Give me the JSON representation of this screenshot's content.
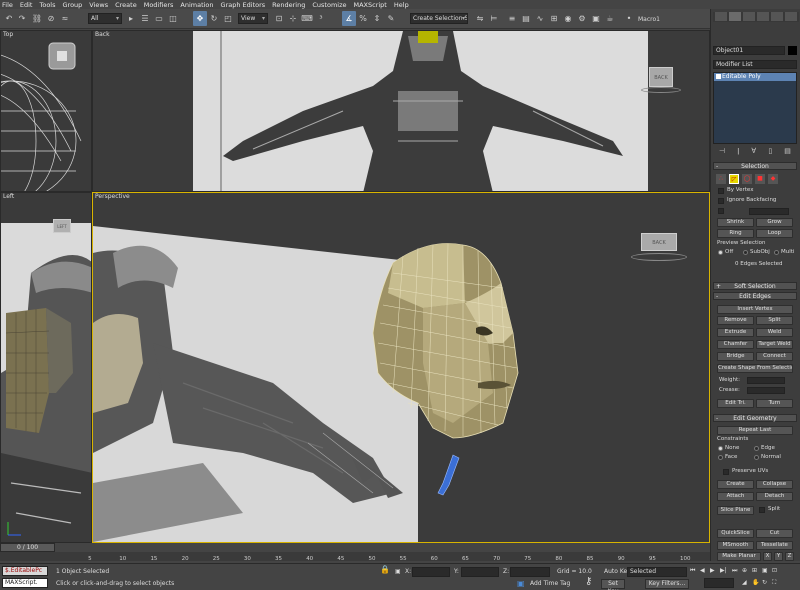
{
  "menu": [
    "File",
    "Edit",
    "Tools",
    "Group",
    "Views",
    "Create",
    "Modifiers",
    "Animation",
    "Graph Editors",
    "Rendering",
    "Customize",
    "MAXScript",
    "Help"
  ],
  "toolbar": {
    "filter_value": "All",
    "refcoord_value": "View",
    "named_selection_placeholder": "Create Selection Se",
    "macro_label": "Macro1"
  },
  "viewports": {
    "top_label": "Top",
    "back_label": "Back",
    "left_label": "Left",
    "perspective_label": "Perspective",
    "viewcube_back": "BACK",
    "viewcube_left": "LEFT",
    "viewcube_persp": "BACK"
  },
  "command_panel": {
    "object_name": "Object01",
    "modifier_list": "Modifier List",
    "stack_item": "Editable Poly",
    "selection": {
      "title": "Selection",
      "by_vertex": "By Vertex",
      "ignore_backfacing": "Ignore Backfacing",
      "shrink": "Shrink",
      "grow": "Grow",
      "ring": "Ring",
      "loop": "Loop",
      "preview_selection": "Preview Selection",
      "off": "Off",
      "subobj": "SubObj",
      "multi": "Multi",
      "status": "0 Edges Selected"
    },
    "soft_selection": "Soft Selection",
    "edit_edges": {
      "title": "Edit Edges",
      "insert_vertex": "Insert Vertex",
      "remove": "Remove",
      "split": "Split",
      "extrude": "Extrude",
      "weld": "Weld",
      "chamfer": "Chamfer",
      "target_weld": "Target Weld",
      "bridge": "Bridge",
      "connect": "Connect",
      "create_shape": "Create Shape From Selection",
      "weight": "Weight:",
      "crease": "Crease:",
      "edit_tri": "Edit Tri.",
      "turn": "Turn"
    },
    "edit_geometry": {
      "title": "Edit Geometry",
      "repeat_last": "Repeat Last",
      "constraints": "Constraints",
      "none": "None",
      "edge": "Edge",
      "face": "Face",
      "normal": "Normal",
      "preserve_uvs": "Preserve UVs",
      "create": "Create",
      "collapse": "Collapse",
      "attach": "Attach",
      "detach": "Detach",
      "slice_plane": "Slice Plane",
      "split": "Split",
      "quickslice": "QuickSlice",
      "cut": "Cut",
      "msmooth": "MSmooth",
      "tessellate": "Tessellate",
      "make_planar": "Make Planar",
      "x": "X",
      "y": "Y",
      "z": "Z"
    }
  },
  "timeline": {
    "slider_label": "0 / 100",
    "ticks": [
      "5",
      "10",
      "15",
      "20",
      "25",
      "30",
      "35",
      "40",
      "45",
      "50",
      "55",
      "60",
      "65",
      "70",
      "75",
      "80",
      "85",
      "90",
      "95",
      "100"
    ]
  },
  "status": {
    "listener_line1": "$.EditablePc",
    "listener_line2": "MAXScript.",
    "selected": "1 Object Selected",
    "prompt": "Click or click-and-drag to select objects",
    "x_label": "X:",
    "y_label": "Y:",
    "z_label": "Z:",
    "grid": "Grid = 10.0",
    "add_time_tag": "Add Time Tag",
    "auto_key": "Auto Key",
    "selected_dropdown": "Selected",
    "set_key": "Set Key",
    "key_filters": "Key Filters..."
  }
}
